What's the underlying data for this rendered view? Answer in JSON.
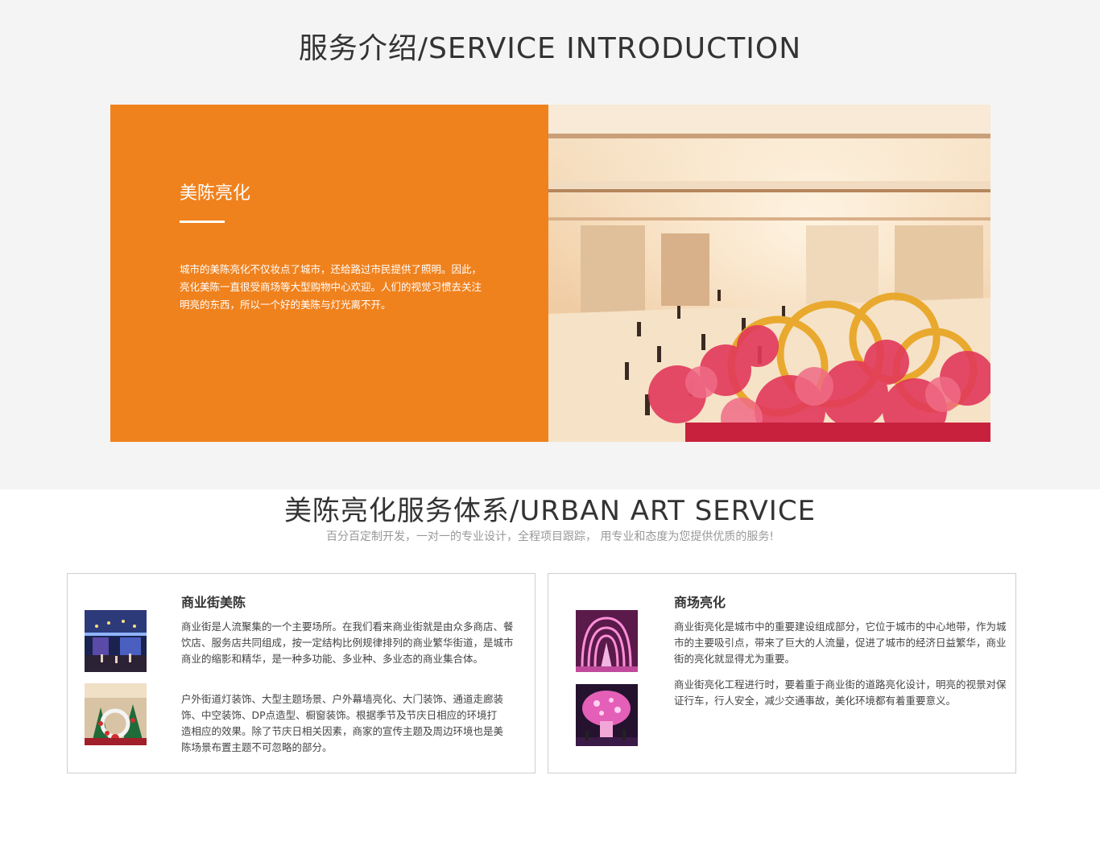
{
  "service_intro": {
    "title": "服务介绍/SERVICE INTRODUCTION",
    "heading": "美陈亮化",
    "description": "城市的美陈亮化不仅妆点了城市，还给路过市民提供了照明。因此，亮化美陈一直很受商场等大型购物中心欢迎。人们的视觉习惯去关注明亮的东西，所以一个好的美陈与灯光离不开。",
    "accent_color": "#f0821e"
  },
  "service_system": {
    "title": "美陈亮化服务体系/URBAN ART SERVICE",
    "subtitle": "百分百定制开发，一对一的专业设计，全程项目跟踪， 用专业和态度为您提供优质的服务!"
  },
  "cards": [
    {
      "title": "商业街美陈",
      "paragraphs": [
        "商业街是人流聚集的一个主要场所。在我们看来商业街就是由众多商店、餐饮店、服务店共同组成，按一定结构比例规律排列的商业繁华街道，是城市商业的缩影和精华，是一种多功能、多业种、多业态的商业集合体。",
        "户外街道灯装饰、大型主题场景、户外幕墙亮化、大门装饰、通道走廊装饰、中空装饰、DP点造型、橱窗装饰。根据季节及节庆日相应的环境打造相应的效果。除了节庆日相关因素，商家的宣传主题及周边环境也是美陈场景布置主题不可忽略的部分。"
      ]
    },
    {
      "title": "商场亮化",
      "paragraphs": [
        "商业街亮化是城市中的重要建设组成部分，它位于城市的中心地带，作为城市的主要吸引点，带来了巨大的人流量，促进了城市的经济日益繁华，商业街的亮化就显得尤为重要。",
        "商业街亮化工程进行时，要着重于商业街的道路亮化设计，明亮的视景对保证行车，行人安全，减少交通事故，美化环境都有着重要意义。"
      ]
    }
  ]
}
